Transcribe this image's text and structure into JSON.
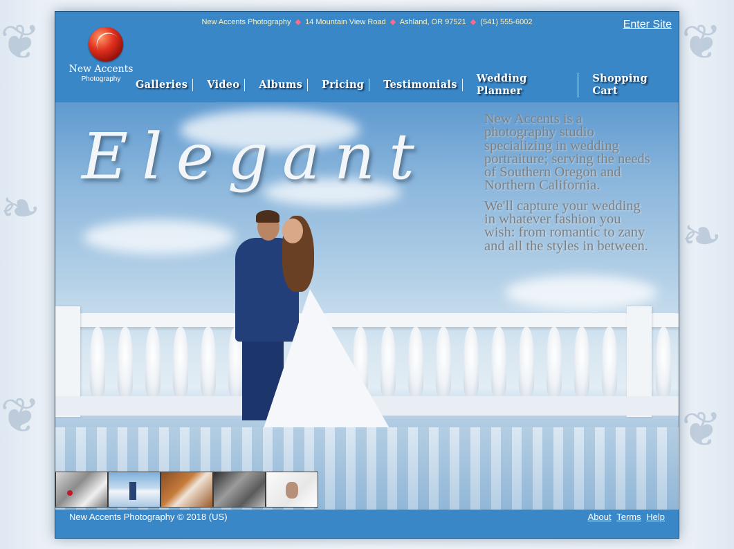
{
  "brand": {
    "logo_name": "New Accents",
    "logo_sub": "Photography"
  },
  "contact": {
    "business": "New Accents Photography",
    "address": "14 Mountain View Road",
    "city": "Ashland, OR 97521",
    "phone": "(541) 555-6002"
  },
  "header": {
    "enter_site": "Enter Site"
  },
  "nav": {
    "items": [
      {
        "label": "Galleries"
      },
      {
        "label": "Video"
      },
      {
        "label": "Albums"
      },
      {
        "label": "Pricing"
      },
      {
        "label": "Testimonials"
      },
      {
        "label": "Wedding Planner"
      },
      {
        "label": "Shopping Cart"
      }
    ]
  },
  "hero": {
    "headline": "Elegant",
    "paragraphs": [
      "New Accents is a photography studio specializing in wedding portraiture; serving the needs of Southern Oregon and Northern California.",
      "We'll capture your wedding in whatever fashion you wish: from romantic to zany and all the styles in between."
    ]
  },
  "thumbnails": [
    "thumb-1",
    "thumb-2",
    "thumb-3",
    "thumb-4",
    "thumb-5"
  ],
  "footer": {
    "copyright": "New Accents Photography © 2018 (US)",
    "links": [
      "About",
      "Terms",
      "Help"
    ]
  },
  "colors": {
    "primary_blue": "#3a87c8",
    "contact_text": "#f7f2c6",
    "diamond": "#ff6b86",
    "hero_text": "#7f7f7f"
  }
}
